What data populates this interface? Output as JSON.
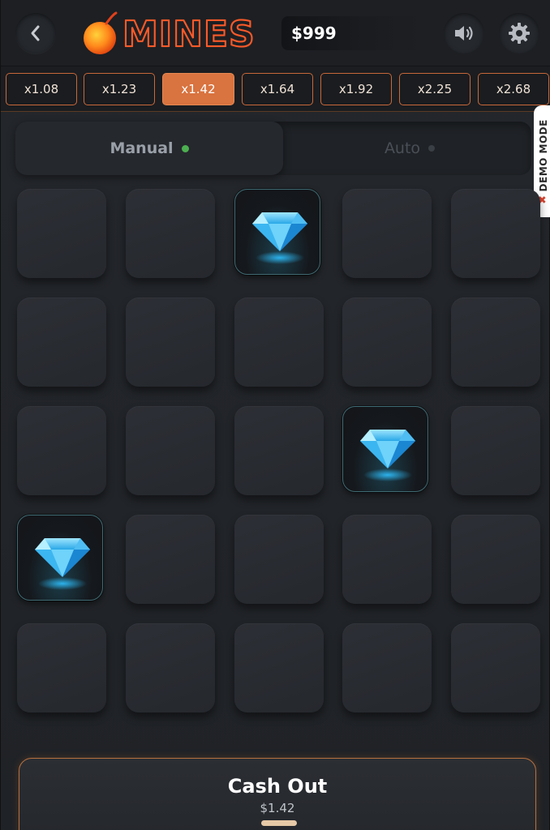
{
  "header": {
    "logo_text": "MINES",
    "balance": "$999"
  },
  "multipliers": [
    "x1.08",
    "x1.23",
    "x1.42",
    "x1.64",
    "x1.92",
    "x2.25",
    "x2.68"
  ],
  "active_multiplier": "x1.42",
  "mode": {
    "manual_label": "Manual",
    "auto_label": "Auto",
    "selected": "Manual"
  },
  "demo_mode_label": "DEMO MODE",
  "grid": {
    "rows": 5,
    "cols": 5,
    "cells": [
      [
        "hidden",
        "hidden",
        "gem",
        "hidden",
        "hidden"
      ],
      [
        "hidden",
        "hidden",
        "hidden",
        "hidden",
        "hidden"
      ],
      [
        "hidden",
        "hidden",
        "hidden",
        "gem",
        "hidden"
      ],
      [
        "gem",
        "hidden",
        "hidden",
        "hidden",
        "hidden"
      ],
      [
        "hidden",
        "hidden",
        "hidden",
        "hidden",
        "hidden"
      ]
    ]
  },
  "cashout": {
    "label": "Cash Out",
    "amount": "$1.42"
  },
  "colors": {
    "accent": "#d9733f",
    "background": "#202328",
    "tile": "#2a2d32",
    "gem": "#4fc3f7",
    "status_dot": "#4caf50"
  }
}
